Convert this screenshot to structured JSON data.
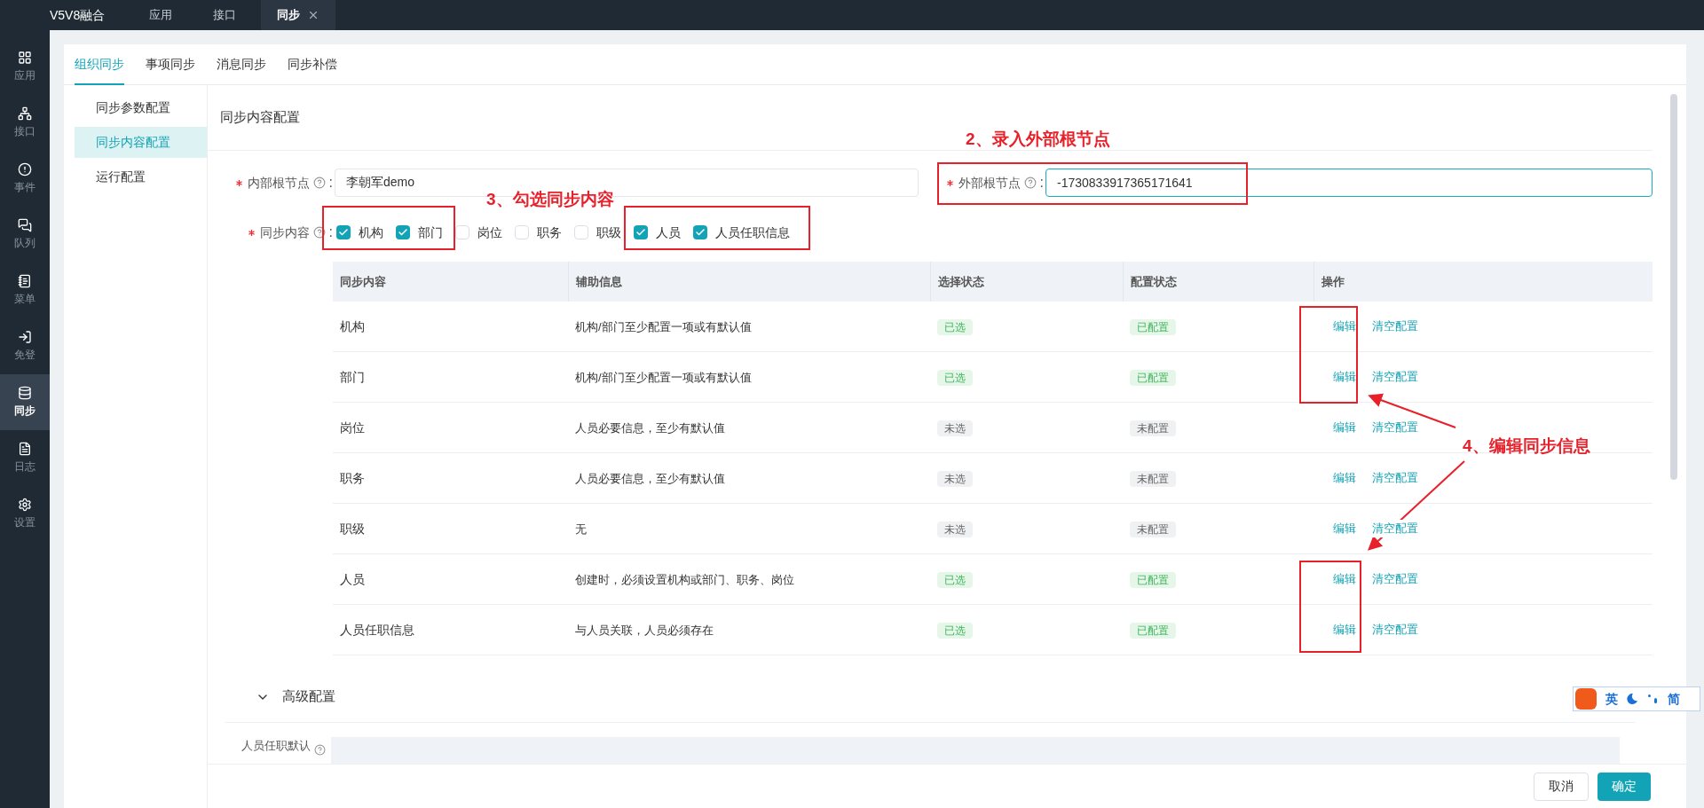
{
  "app": {
    "title": "V5V8融合"
  },
  "top_tabs": [
    {
      "label": "应用",
      "selected": false,
      "closable": false
    },
    {
      "label": "接口",
      "selected": false,
      "closable": false
    },
    {
      "label": "同步",
      "selected": true,
      "closable": true
    }
  ],
  "sidebar": [
    {
      "label": "应用",
      "selected": false
    },
    {
      "label": "接口",
      "selected": false
    },
    {
      "label": "事件",
      "selected": false
    },
    {
      "label": "队列",
      "selected": false
    },
    {
      "label": "菜单",
      "selected": false
    },
    {
      "label": "免登",
      "selected": false
    },
    {
      "label": "同步",
      "selected": true
    },
    {
      "label": "日志",
      "selected": false
    },
    {
      "label": "设置",
      "selected": false
    }
  ],
  "page_tabs": [
    {
      "label": "组织同步",
      "selected": true
    },
    {
      "label": "事项同步",
      "selected": false
    },
    {
      "label": "消息同步",
      "selected": false
    },
    {
      "label": "同步补偿",
      "selected": false
    }
  ],
  "side_menu": [
    {
      "label": "同步参数配置",
      "selected": false
    },
    {
      "label": "同步内容配置",
      "selected": true
    },
    {
      "label": "运行配置",
      "selected": false
    }
  ],
  "section_title": "同步内容配置",
  "form": {
    "internal_root": {
      "label": "内部根节点",
      "suffix": ":",
      "required": true,
      "value": "李朝军demo",
      "focused": false
    },
    "external_root": {
      "label": "外部根节点",
      "suffix": ":",
      "required": true,
      "value": "-1730833917365171641",
      "focused": true
    },
    "sync_content": {
      "label": "同步内容",
      "suffix": ":",
      "required": true,
      "options": [
        {
          "label": "机构",
          "checked": true
        },
        {
          "label": "部门",
          "checked": true
        },
        {
          "label": "岗位",
          "checked": false
        },
        {
          "label": "职务",
          "checked": false
        },
        {
          "label": "职级",
          "checked": false
        },
        {
          "label": "人员",
          "checked": true
        },
        {
          "label": "人员任职信息",
          "checked": true
        }
      ]
    }
  },
  "table": {
    "columns": [
      "同步内容",
      "辅助信息",
      "选择状态",
      "配置状态",
      "操作"
    ],
    "rows": [
      {
        "content": "机构",
        "info": "机构/部门至少配置一项或有默认值",
        "selection": "已选",
        "selected": true,
        "config": "已配置",
        "configured": true,
        "actions": [
          "编辑",
          "清空配置"
        ]
      },
      {
        "content": "部门",
        "info": "机构/部门至少配置一项或有默认值",
        "selection": "已选",
        "selected": true,
        "config": "已配置",
        "configured": true,
        "actions": [
          "编辑",
          "清空配置"
        ]
      },
      {
        "content": "岗位",
        "info": "人员必要信息，至少有默认值",
        "selection": "未选",
        "selected": false,
        "config": "未配置",
        "configured": false,
        "actions": [
          "编辑",
          "清空配置"
        ]
      },
      {
        "content": "职务",
        "info": "人员必要信息，至少有默认值",
        "selection": "未选",
        "selected": false,
        "config": "未配置",
        "configured": false,
        "actions": [
          "编辑",
          "清空配置"
        ]
      },
      {
        "content": "职级",
        "info": "无",
        "selection": "未选",
        "selected": false,
        "config": "未配置",
        "configured": false,
        "actions": [
          "编辑",
          "清空配置"
        ]
      },
      {
        "content": "人员",
        "info": "创建时，必须设置机构或部门、职务、岗位",
        "selection": "已选",
        "selected": true,
        "config": "已配置",
        "configured": true,
        "actions": [
          "编辑",
          "清空配置"
        ]
      },
      {
        "content": "人员任职信息",
        "info": "与人员关联，人员必须存在",
        "selection": "已选",
        "selected": true,
        "config": "已配置",
        "configured": true,
        "actions": [
          "编辑",
          "清空配置"
        ]
      }
    ]
  },
  "advanced": {
    "title": "高级配置",
    "expanded": true,
    "field_label": "人员任职默认"
  },
  "footer": {
    "buttons": [
      {
        "label": "取消",
        "kind": "default"
      },
      {
        "label": "确定",
        "kind": "primary"
      }
    ]
  },
  "ime": {
    "mode": "英",
    "script": "简"
  },
  "annotations": [
    {
      "text": "2、录入外部根节点"
    },
    {
      "text": "3、勾选同步内容"
    },
    {
      "text": "4、编辑同步信息"
    }
  ]
}
